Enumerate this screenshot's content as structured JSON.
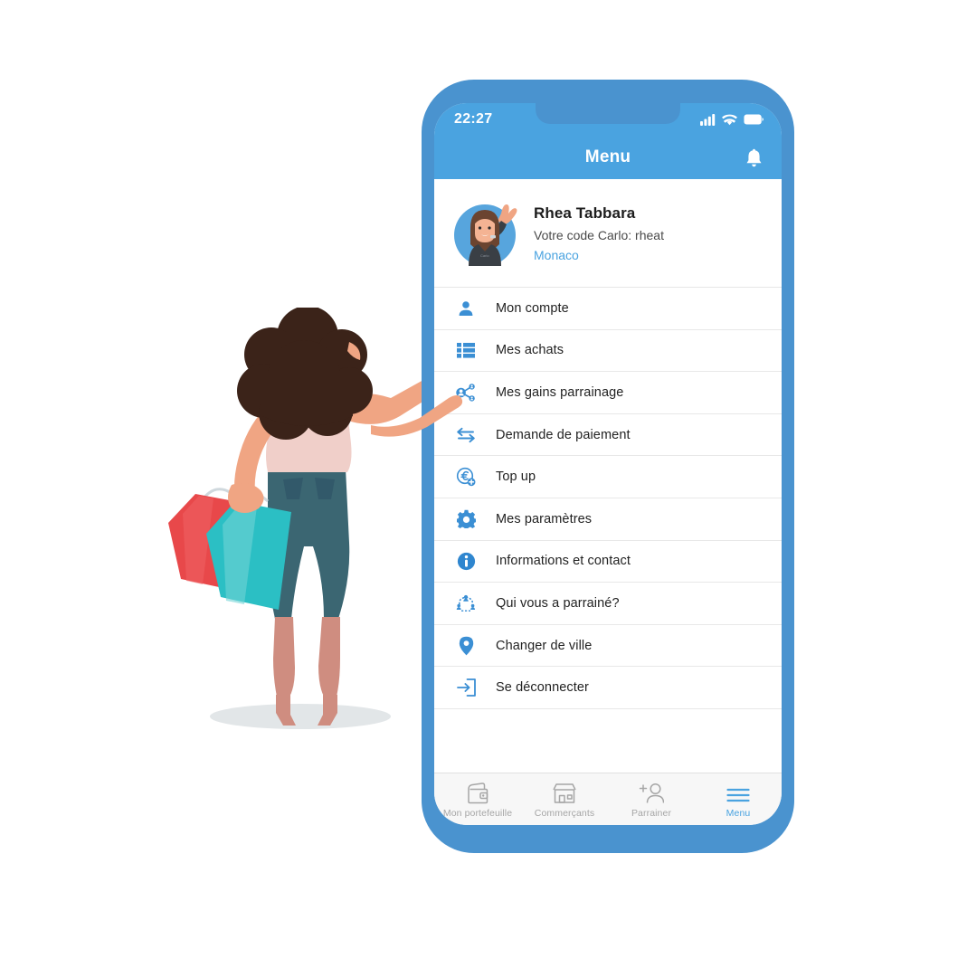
{
  "status_bar": {
    "time": "22:27",
    "signal_icon": "cellular-signal-icon",
    "wifi_icon": "wifi-icon",
    "battery_icon": "battery-icon"
  },
  "app_bar": {
    "title": "Menu",
    "notification_icon": "bell-icon"
  },
  "profile": {
    "avatar_icon": "user-avatar",
    "name": "Rhea Tabbara",
    "referral_code": "Votre code Carlo: rheat",
    "city": "Monaco"
  },
  "menu": {
    "items": [
      {
        "label": "Mon compte",
        "icon": "person-icon"
      },
      {
        "label": "Mes achats",
        "icon": "list-icon"
      },
      {
        "label": "Mes gains parrainage",
        "icon": "share-network-icon"
      },
      {
        "label": "Demande de paiement",
        "icon": "exchange-arrows-icon"
      },
      {
        "label": "Top up",
        "icon": "euro-coin-plus-icon"
      },
      {
        "label": "Mes paramètres",
        "icon": "gear-icon"
      },
      {
        "label": "Informations et contact",
        "icon": "info-circle-icon"
      },
      {
        "label": "Qui vous a parrainé?",
        "icon": "network-people-icon"
      },
      {
        "label": "Changer de ville",
        "icon": "map-pin-icon"
      },
      {
        "label": "Se déconnecter",
        "icon": "logout-icon"
      }
    ]
  },
  "bottom_nav": {
    "items": [
      {
        "label": "Mon portefeuille",
        "icon": "wallet-icon",
        "active": false
      },
      {
        "label": "Commerçants",
        "icon": "storefront-icon",
        "active": false
      },
      {
        "label": "Parrainer",
        "icon": "add-person-icon",
        "active": false
      },
      {
        "label": "Menu",
        "icon": "hamburger-icon",
        "active": true
      }
    ]
  },
  "illustration": {
    "name": "woman-with-shopping-bags-pointing-at-phone",
    "hair_color": "#3b2319",
    "skin_color": "#f0a583",
    "shirt_color": "#f0cfc9",
    "jeans_color": "#3b6672",
    "bag_red": "#e8484a",
    "bag_teal": "#2bbfc4"
  },
  "colors": {
    "brand_blue": "#4aa3e0",
    "frame_blue": "#4a93cf",
    "divider": "#e8e8e8",
    "nav_inactive": "#a6a6a6",
    "bottom_nav_bg": "#f7f7f7"
  }
}
